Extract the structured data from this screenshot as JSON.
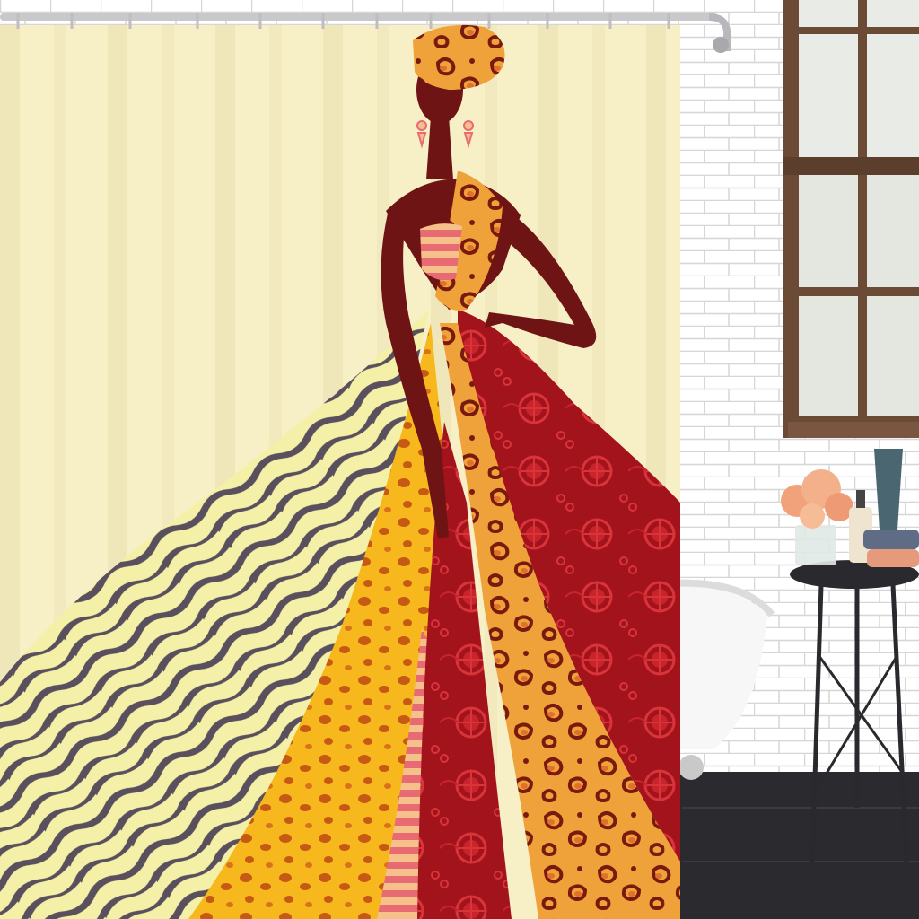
{
  "scene": {
    "colors": {
      "curtain_bg": "#f7efc6",
      "skin": "#6e1414",
      "leopard_base": "#f0a23a",
      "leopard_spot": "#7a1a0f",
      "cheetah_base": "#f6b81c",
      "cheetah_spot": "#c65a14",
      "red_panel": "#a3131b",
      "red_motif": "#d8343a",
      "zebra_light": "#f4f0a8",
      "zebra_dark": "#5a4f5c",
      "stripe_a": "#e86a72",
      "stripe_b": "#f6c08a",
      "tile": "#ffffff",
      "grout": "#d8d8d8",
      "floor": "#2b2b2f",
      "window_frame": "#6b4a36",
      "flowers": "#f2a27a"
    },
    "icons": [
      "shower-rod",
      "curtain-hooks",
      "window",
      "bathtub",
      "side-table",
      "flower-vase",
      "soap-bottle",
      "pitcher",
      "towel-stack"
    ]
  }
}
